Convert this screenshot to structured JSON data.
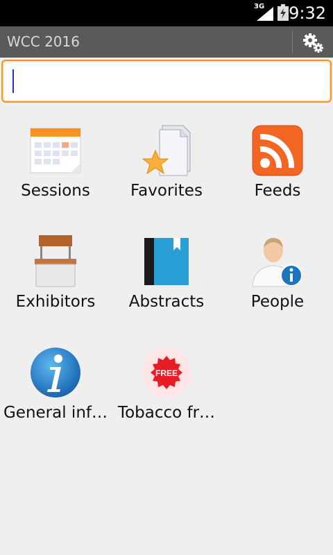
{
  "status": {
    "network": "3G",
    "time": "9:32"
  },
  "actionbar": {
    "title": "WCC 2016",
    "settings_icon": "settings-gears-icon"
  },
  "search": {
    "value": "",
    "placeholder": ""
  },
  "accent": "#f7931e",
  "tiles": [
    {
      "label": "Sessions",
      "icon": "calendar-icon"
    },
    {
      "label": "Favorites",
      "icon": "favorites-star-icon"
    },
    {
      "label": "Feeds",
      "icon": "rss-icon"
    },
    {
      "label": "Exhibitors",
      "icon": "exhibitor-booth-icon"
    },
    {
      "label": "Abstracts",
      "icon": "book-icon"
    },
    {
      "label": "People",
      "icon": "person-info-icon"
    },
    {
      "label": "General inf…",
      "icon": "info-icon"
    },
    {
      "label": "Tobacco fr…",
      "icon": "free-badge-icon",
      "badge_text": "FREE"
    }
  ]
}
